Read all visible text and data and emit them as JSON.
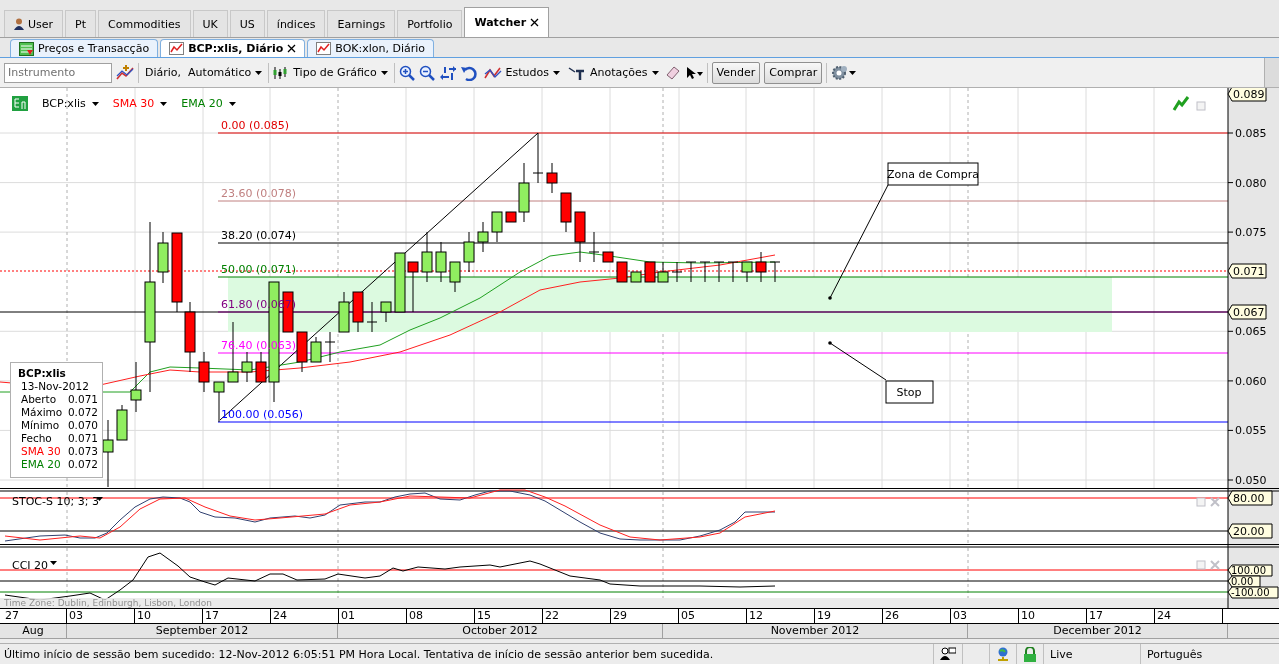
{
  "top_tabs": [
    {
      "label": "User",
      "kind": "user",
      "selected": false,
      "closable": false
    },
    {
      "label": "Pt",
      "kind": "plain",
      "selected": false,
      "closable": false
    },
    {
      "label": "Commodities",
      "kind": "plain",
      "selected": false,
      "closable": false
    },
    {
      "label": "UK",
      "kind": "plain",
      "selected": false,
      "closable": false
    },
    {
      "label": "US",
      "kind": "plain",
      "selected": false,
      "closable": false
    },
    {
      "label": "índices",
      "kind": "plain",
      "selected": false,
      "closable": false
    },
    {
      "label": "Earnings",
      "kind": "plain",
      "selected": false,
      "closable": false
    },
    {
      "label": "Portfolio",
      "kind": "plain",
      "selected": false,
      "closable": false
    },
    {
      "label": "Watcher",
      "kind": "plain",
      "selected": true,
      "closable": true
    }
  ],
  "doc_tabs": [
    {
      "label": "Preços e Transacção",
      "kind": "prices",
      "selected": false,
      "closable": false
    },
    {
      "label": "BCP:xlis, Diário",
      "kind": "chart",
      "selected": true,
      "closable": true
    },
    {
      "label": "BOK:xlon, Diário",
      "kind": "chart",
      "selected": false,
      "closable": false
    }
  ],
  "toolbar": {
    "instrument": {
      "placeholder": "Instrumento"
    },
    "interval": "Diário,  Automático",
    "chart_type": "Tipo de Gráfico",
    "studies": "Estudos",
    "annotations": "Anotações",
    "sell": "Vender",
    "buy": "Comprar"
  },
  "chart": {
    "legend": [
      {
        "label": "BCP:xlis",
        "color": "#000000"
      },
      {
        "label": "SMA 30",
        "color": "#ff0000"
      },
      {
        "label": "EMA 20",
        "color": "#008000"
      }
    ],
    "fib_levels": [
      {
        "label": "0.00 (0.085)",
        "color": "#e00000"
      },
      {
        "label": "23.60 (0.078)",
        "color": "#c08080"
      },
      {
        "label": "38.20 (0.074)",
        "color": "#000000"
      },
      {
        "label": "50.00 (0.071)",
        "color": "#008000"
      },
      {
        "label": "61.80 (0.067)",
        "color": "#800080"
      },
      {
        "label": "76.40 (0.063)",
        "color": "#ff00ff"
      },
      {
        "label": "100.00 (0.056)",
        "color": "#0000ff"
      }
    ],
    "notes": [
      {
        "text": "Zona de Compra"
      },
      {
        "text": "Stop"
      }
    ],
    "info_box": {
      "title": "BCP:xlis",
      "date": "13-Nov-2012",
      "rows": [
        {
          "label": "Aberto",
          "value": "0.071",
          "color": "#000000"
        },
        {
          "label": "Máximo",
          "value": "0.072",
          "color": "#000000"
        },
        {
          "label": "Mínimo",
          "value": "0.070",
          "color": "#000000"
        },
        {
          "label": "Fecho",
          "value": "0.071",
          "color": "#000000"
        },
        {
          "label": "SMA 30",
          "value": "0.073",
          "color": "#ff0000"
        },
        {
          "label": "EMA 20",
          "value": "0.072",
          "color": "#008000"
        }
      ]
    },
    "price_ticks": [
      "0.085",
      "0.080",
      "0.075",
      "0.065",
      "0.060",
      "0.055",
      "0.050"
    ],
    "price_markers": [
      "0.089",
      "0.071",
      "0.067"
    ]
  },
  "stoc": {
    "label": "STOC-S 10; 3; 3",
    "markers": [
      "80.00",
      "20.00"
    ]
  },
  "cci": {
    "label": "CCI 20",
    "markers": [
      "100.00",
      "0.00",
      "-100.00"
    ]
  },
  "time_zone": "Time Zone: Dublin, Edinburgh, Lisbon, London",
  "dates": [
    "27",
    "03",
    "10",
    "17",
    "24",
    "01",
    "08",
    "15",
    "22",
    "29",
    "05",
    "12",
    "19",
    "26",
    "03",
    "10",
    "17",
    "24"
  ],
  "months": [
    "Aug",
    "September 2012",
    "October 2012",
    "November 2012",
    "December 2012"
  ],
  "status_bar": {
    "message": "Último início de sessão bem sucedido: 12-Nov-2012 6:05:51 PM Hora Local. Tentativa de início de sessão anterior bem sucedida.",
    "connection": "Live",
    "language": "Português"
  }
}
